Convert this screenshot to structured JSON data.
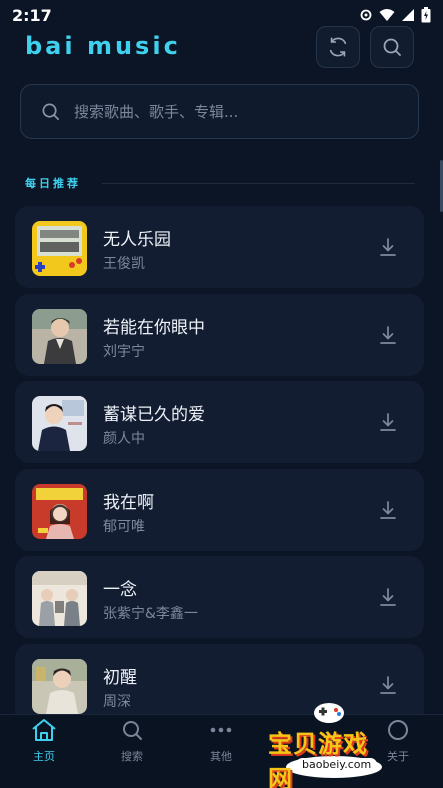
{
  "status_bar": {
    "time": "2:17"
  },
  "header": {
    "brand": "bai music"
  },
  "search": {
    "placeholder": "搜索歌曲、歌手、专辑..."
  },
  "section": {
    "title": "每日推荐"
  },
  "songs": [
    {
      "title": "无人乐园",
      "artist": "王俊凯"
    },
    {
      "title": "若能在你眼中",
      "artist": "刘宇宁"
    },
    {
      "title": "蓄谋已久的爱",
      "artist": "颜人中"
    },
    {
      "title": "我在啊",
      "artist": "郁可唯"
    },
    {
      "title": "一念",
      "artist": "张紫宁&李鑫一"
    },
    {
      "title": "初醒",
      "artist": "周深"
    }
  ],
  "nav": {
    "items": [
      {
        "label": "主页",
        "icon": "home-icon"
      },
      {
        "label": "搜索",
        "icon": "search-icon"
      },
      {
        "label": "其他",
        "icon": "more-icon"
      },
      {
        "label": "关于",
        "icon": "info-icon"
      }
    ]
  },
  "watermark": {
    "text": "宝贝游戏网",
    "url": "baobeiy.com"
  },
  "colors": {
    "accent": "#3fd0ee",
    "background": "#0c1526",
    "card": "#121d31"
  }
}
